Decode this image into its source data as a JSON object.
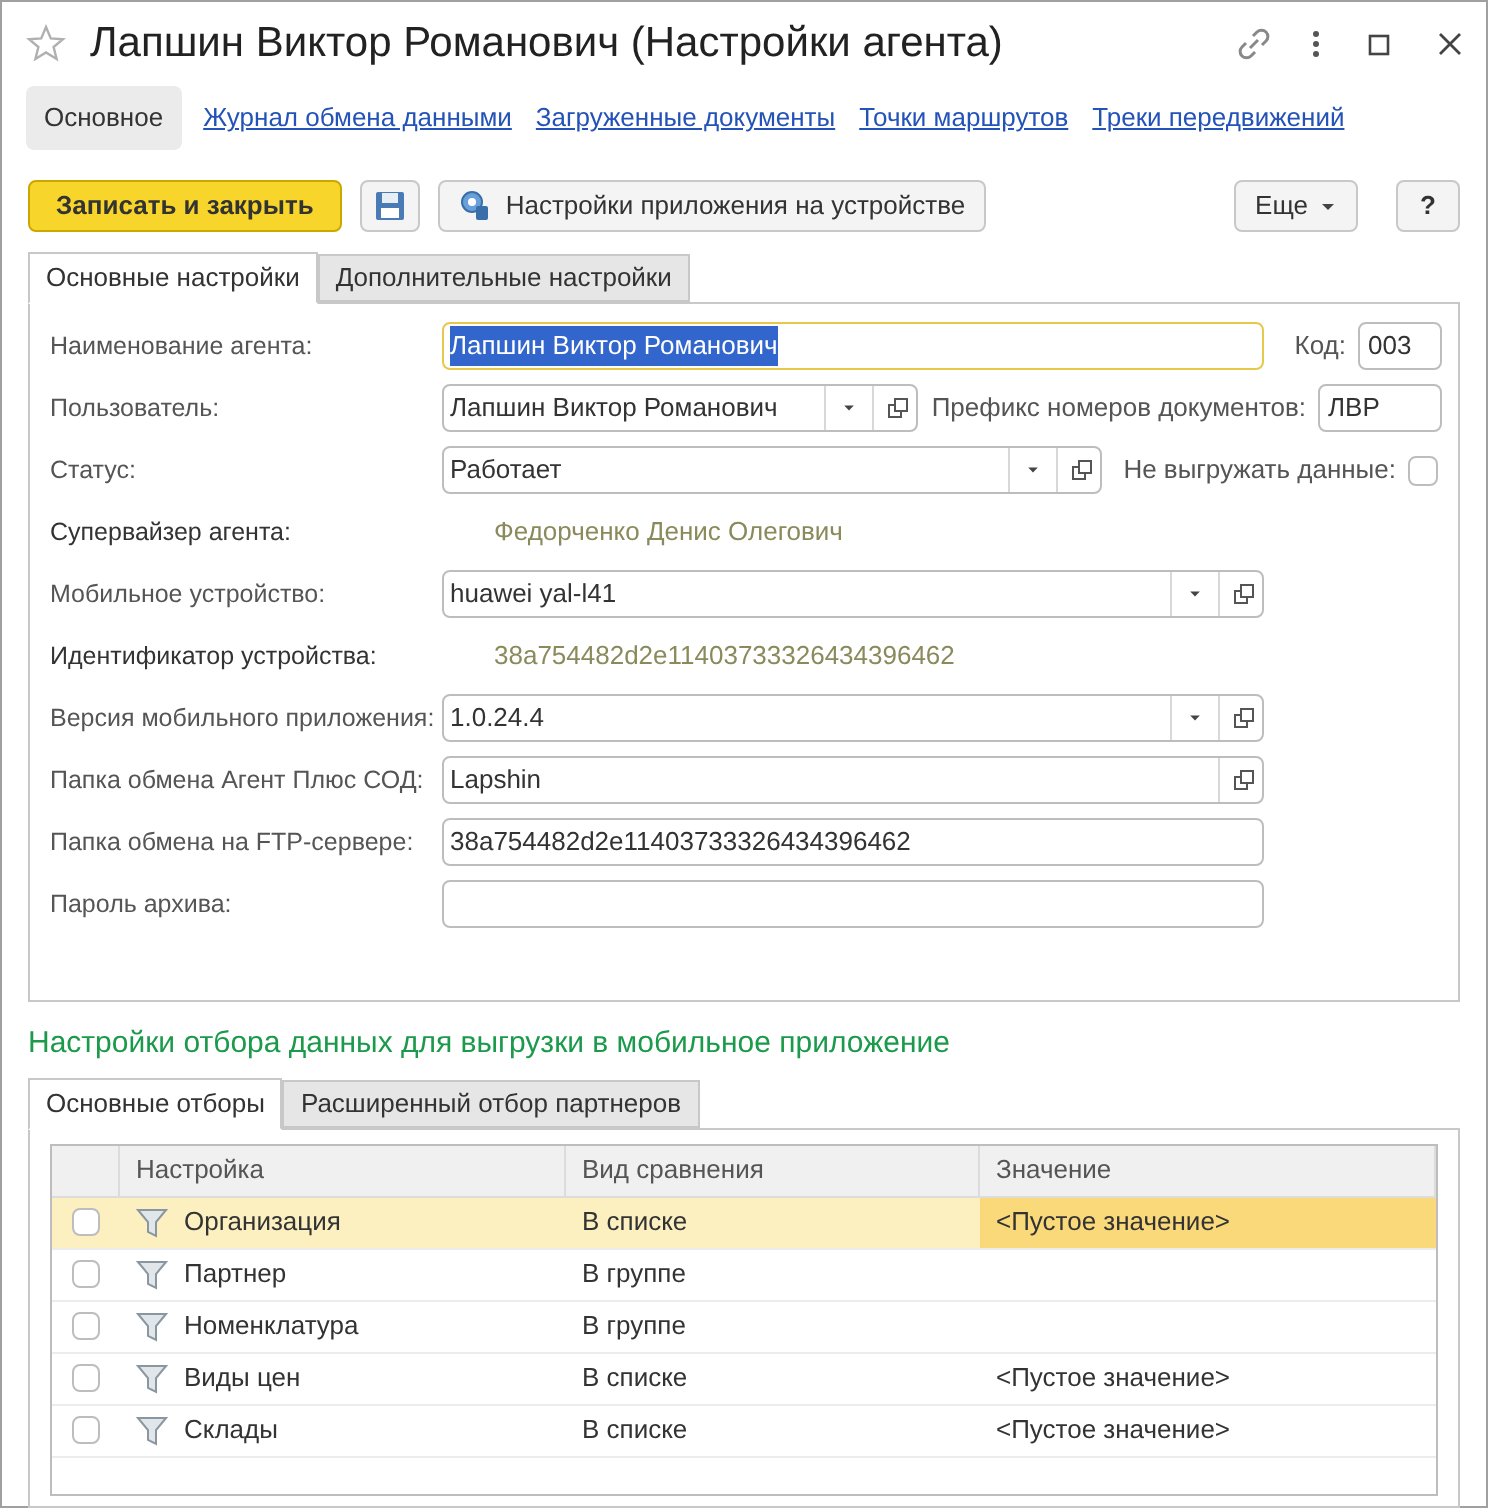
{
  "window": {
    "title": "Лапшин Виктор Романович (Настройки агента)",
    "favorite": false
  },
  "nav": [
    {
      "label": "Основное",
      "selected": true
    },
    {
      "label": "Журнал обмена данными",
      "selected": false
    },
    {
      "label": "Загруженные документы",
      "selected": false
    },
    {
      "label": "Точки маршрутов",
      "selected": false
    },
    {
      "label": "Треки передвижений",
      "selected": false
    }
  ],
  "toolbar": {
    "primary": "Записать и закрыть",
    "settings": "Настройки приложения на устройстве",
    "more": "Еще",
    "help": "?"
  },
  "tabs": [
    {
      "label": "Основные настройки",
      "selected": true
    },
    {
      "label": "Дополнительные настройки",
      "selected": false
    }
  ],
  "fields": [
    {
      "label": "Наименование агента:",
      "kind": "input",
      "value": "Лапшин Виктор Романович",
      "focused": true,
      "side": {
        "kind": "input",
        "label": "Код:",
        "value": "003"
      }
    },
    {
      "label": "Пользователь:",
      "kind": "select",
      "value": "Лапшин Виктор Романович",
      "side": {
        "kind": "input",
        "label": "Префикс номеров документов:",
        "value": "ЛВР"
      }
    },
    {
      "label": "Статус:",
      "kind": "select",
      "value": "Работает",
      "side": {
        "kind": "checkbox",
        "label": "Не выгружать данные:",
        "checked": false
      }
    },
    {
      "label": "Супервайзер агента:",
      "kind": "text",
      "value": "Федорченко Денис Олегович"
    },
    {
      "label": "Мобильное устройство:",
      "kind": "select",
      "value": "huawei yal-l41"
    },
    {
      "label": "Идентификатор устройства:",
      "kind": "text",
      "value": "38a754482d2e11403733326434396462"
    },
    {
      "label": "Версия мобильного приложения:",
      "kind": "select",
      "value": "1.0.24.4"
    },
    {
      "label": "Папка обмена Агент Плюс СОД:",
      "kind": "open",
      "value": "Lapshin"
    },
    {
      "label": "Папка обмена на FTP-сервере:",
      "kind": "input",
      "value": "38a754482d2e11403733326434396462",
      "focused": false
    },
    {
      "label": "Пароль архива:",
      "kind": "input",
      "focused": false
    }
  ],
  "section_title": "Настройки отбора данных для выгрузки в мобильное приложение",
  "filter_tabs": [
    {
      "label": "Основные отборы",
      "selected": true
    },
    {
      "label": "Расширенный отбор партнеров",
      "selected": false
    }
  ],
  "table": {
    "columns": [
      "Настройка",
      "Вид сравнения",
      "Значение"
    ],
    "rows": [
      {
        "checked": false,
        "selected": true,
        "setting": "Организация",
        "comparison": "В списке",
        "value": "<Пустое значение>"
      },
      {
        "checked": false,
        "selected": false,
        "setting": "Партнер",
        "comparison": "В группе"
      },
      {
        "checked": false,
        "selected": false,
        "setting": "Номенклатура",
        "comparison": "В группе"
      },
      {
        "checked": false,
        "selected": false,
        "setting": "Виды цен",
        "comparison": "В списке",
        "value": "<Пустое значение>"
      },
      {
        "checked": false,
        "selected": false,
        "setting": "Склады",
        "comparison": "В списке",
        "value": "<Пустое значение>"
      }
    ]
  }
}
